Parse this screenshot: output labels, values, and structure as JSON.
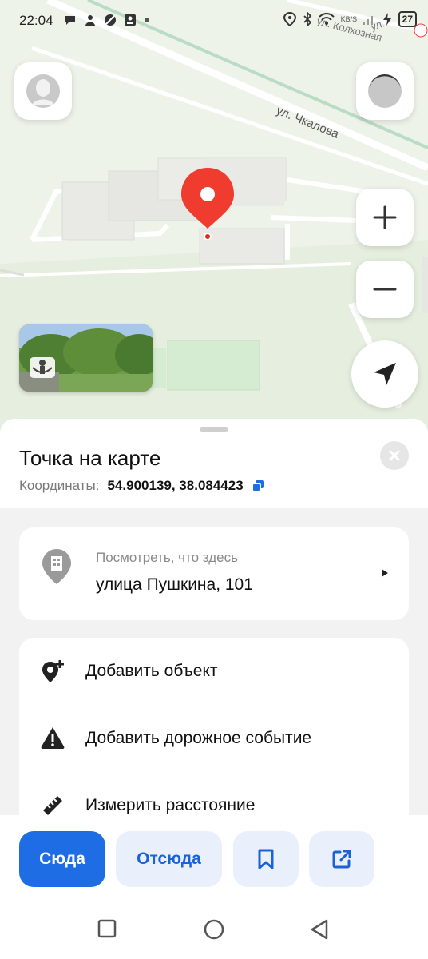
{
  "status_bar": {
    "time": "22:04",
    "battery": "27",
    "network_label": "KB/S"
  },
  "map": {
    "street_labels": [
      "ул. Чкалова",
      "ул. Колхозная",
      "ул."
    ],
    "buttons": {
      "avatar": "avatar-icon",
      "layers": "layers-icon",
      "zoom_in": "+",
      "zoom_out": "−",
      "locate": "navigation-arrow-icon"
    }
  },
  "place": {
    "title": "Точка на карте",
    "coords_label": "Координаты:",
    "coords_value": "54.900139, 38.084423"
  },
  "whats_here": {
    "subtitle": "Посмотреть, что здесь",
    "address": "улица Пушкина, 101"
  },
  "actions": [
    {
      "label": "Добавить объект",
      "icon": "add-place-icon"
    },
    {
      "label": "Добавить дорожное событие",
      "icon": "warning-icon"
    },
    {
      "label": "Измерить расстояние",
      "icon": "ruler-icon"
    }
  ],
  "bottom_buttons": {
    "here": "Сюда",
    "from": "Отсюда",
    "save": "bookmark-icon",
    "share": "share-icon"
  },
  "colors": {
    "accent": "#1e6de4",
    "pin": "#f03c2e",
    "map_bg": "#eef3ea"
  }
}
